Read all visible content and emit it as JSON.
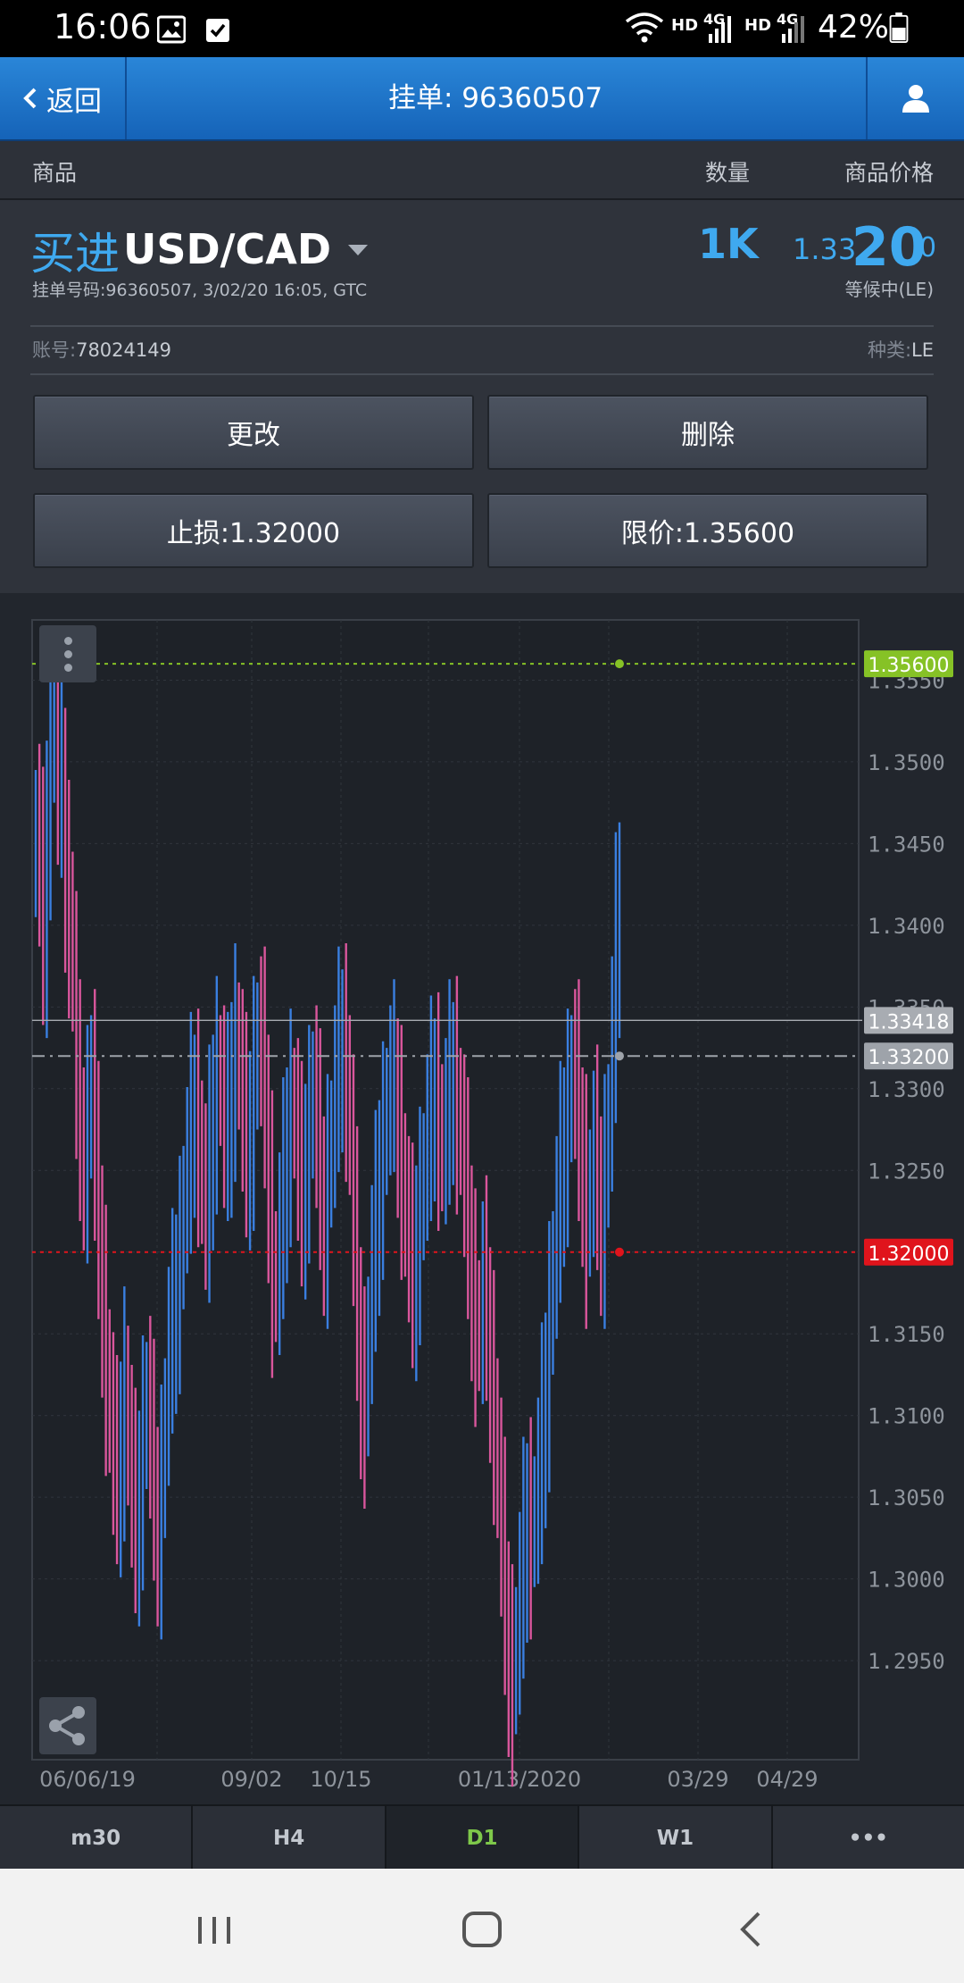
{
  "status_bar": {
    "time": "16:06",
    "hd1": "HD",
    "net1": "4G",
    "hd2": "HD",
    "net2": "4G",
    "battery": "42%"
  },
  "nav": {
    "back_label": "返回",
    "title": "挂单: 96360507"
  },
  "columns": {
    "product": "商品",
    "quantity": "数量",
    "price": "商品价格"
  },
  "order": {
    "side": "买进",
    "symbol": "USD/CAD",
    "meta": "挂单号码:96360507,  3/02/20 16:05, GTC",
    "quantity": "1K",
    "price_prefix": "1.33",
    "price_big": "20",
    "price_pip": "0",
    "status": "等候中(LE)",
    "account_label": "账号:",
    "account": "78024149",
    "type_label": "种类:",
    "type": "LE"
  },
  "buttons": {
    "modify": "更改",
    "delete": "删除",
    "stop_loss": "止损:1.32000",
    "limit": "限价:1.35600"
  },
  "chart_data": {
    "type": "candlestick",
    "ylim": [
      1.292,
      1.3595
    ],
    "y_ticks": [
      "1.3550",
      "1.3500",
      "1.3450",
      "1.3400",
      "1.3350",
      "1.3300",
      "1.3250",
      "1.3200",
      "1.3150",
      "1.3100",
      "1.3050",
      "1.3000",
      "1.2950"
    ],
    "x_ticks": [
      "06/06/19",
      "09/02",
      "10/15",
      "01/13/2020",
      "03/29",
      "04/29"
    ],
    "price_lines": [
      {
        "label": "1.35600",
        "value": 1.356,
        "color": "#86c226",
        "style": "dotted"
      },
      {
        "label": "1.33418",
        "value": 1.33418,
        "color": "#a8acb2",
        "style": "solid"
      },
      {
        "label": "1.33200",
        "value": 1.332,
        "color": "#9ea3aa",
        "style": "dashdot"
      },
      {
        "label": "1.32000",
        "value": 1.32,
        "color": "#e0141c",
        "style": "dotted"
      }
    ],
    "series_colors": {
      "up": "#3a7fe0",
      "down": "#d9569c"
    },
    "close": [
      1.346,
      1.343,
      1.339,
      1.347,
      1.351,
      1.352,
      1.348,
      1.349,
      1.343,
      1.341,
      1.337,
      1.33,
      1.327,
      1.326,
      1.328,
      1.331,
      1.325,
      1.321,
      1.317,
      1.313,
      1.31,
      1.307,
      1.306,
      1.309,
      1.312,
      1.308,
      1.305,
      1.303,
      1.306,
      1.309,
      1.311,
      1.308,
      1.305,
      1.303,
      1.306,
      1.31,
      1.314,
      1.316,
      1.318,
      1.32,
      1.323,
      1.325,
      1.328,
      1.329,
      1.327,
      1.324,
      1.322,
      1.326,
      1.329,
      1.331,
      1.33,
      1.327,
      1.328,
      1.331,
      1.333,
      1.331,
      1.328,
      1.326,
      1.328,
      1.331,
      1.333,
      1.332,
      1.329,
      1.324,
      1.319,
      1.318,
      1.321,
      1.324,
      1.327,
      1.329,
      1.328,
      1.325,
      1.323,
      1.326,
      1.328,
      1.33,
      1.327,
      1.324,
      1.322,
      1.325,
      1.327,
      1.33,
      1.332,
      1.333,
      1.331,
      1.327,
      1.321,
      1.316,
      1.312,
      1.311,
      1.315,
      1.319,
      1.322,
      1.325,
      1.327,
      1.329,
      1.33,
      1.33,
      1.328,
      1.325,
      1.322,
      1.32,
      1.318,
      1.321,
      1.323,
      1.325,
      1.327,
      1.329,
      1.33,
      1.328,
      1.326,
      1.328,
      1.33,
      1.331,
      1.329,
      1.327,
      1.324,
      1.321,
      1.318,
      1.316,
      1.315,
      1.318,
      1.316,
      1.313,
      1.31,
      1.306,
      1.302,
      1.298,
      1.295,
      1.294,
      1.296,
      1.299,
      1.302,
      1.304,
      1.303,
      1.304,
      1.306,
      1.309,
      1.312,
      1.316,
      1.319,
      1.322,
      1.325,
      1.327,
      1.329,
      1.331,
      1.33,
      1.327,
      1.325,
      1.322,
      1.324,
      1.326,
      1.324,
      1.322,
      1.325,
      1.328,
      1.333,
      1.339,
      1.342
    ]
  },
  "timeframes": [
    "m30",
    "H4",
    "D1",
    "W1",
    "•••"
  ],
  "active_timeframe": "D1"
}
